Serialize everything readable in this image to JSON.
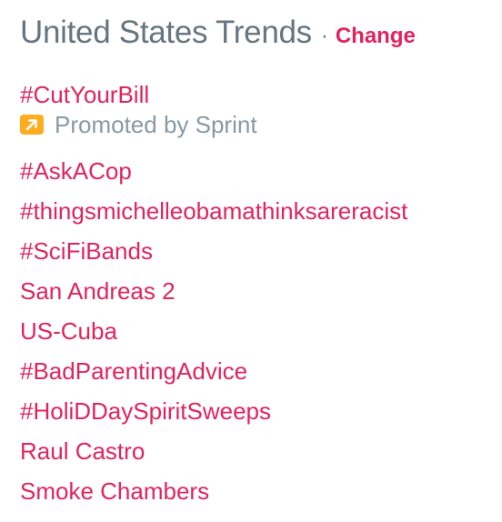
{
  "header": {
    "title": "United States Trends",
    "separator": "·",
    "change_label": "Change"
  },
  "colors": {
    "link": "#e0245e",
    "muted": "#66757f",
    "promoted_text": "#8899a6",
    "promoted_badge": "#ffad1f"
  },
  "promoted": {
    "name": "#CutYourBill",
    "label": "Promoted by Sprint",
    "icon": "promoted-arrow-icon"
  },
  "trends": [
    "#AskACop",
    "#thingsmichelleobamathinksareracist",
    "#SciFiBands",
    "San Andreas 2",
    "US-Cuba",
    "#BadParentingAdvice",
    "#HoliDDaySpiritSweeps",
    "Raul Castro",
    "Smoke Chambers"
  ]
}
